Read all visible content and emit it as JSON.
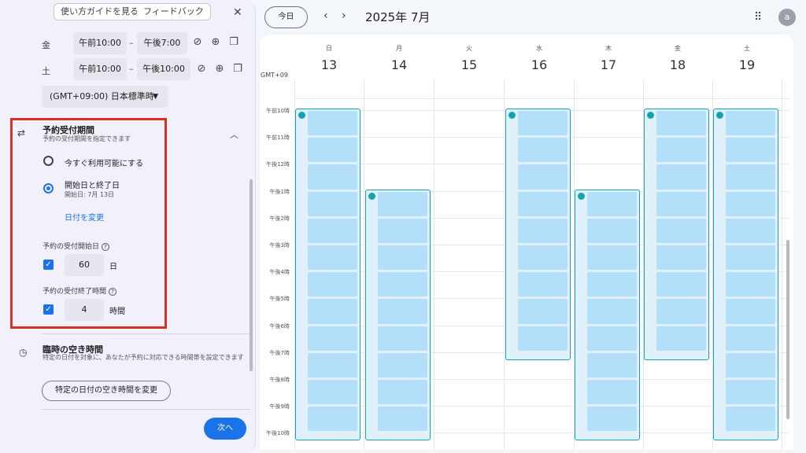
{
  "panel": {
    "guide_label": "使い方ガイドを見る",
    "feedback_label": "フィードバック",
    "close_icon": "close-icon",
    "hours": [
      {
        "day": "金",
        "start": "午前10:00",
        "end": "午後7:00"
      },
      {
        "day": "土",
        "start": "午前10:00",
        "end": "午後10:00"
      }
    ],
    "dash": "–",
    "timezone": "(GMT+09:00) 日本標準時",
    "booking_window": {
      "title": "予約受付期間",
      "subtitle": "予約の受付期間を指定できます",
      "option_now": "今すぐ利用可能にする",
      "option_range": "開始日と終了日",
      "option_range_sub": "開始日: 7月 13日",
      "selected": "option_range",
      "change_date": "日付を変更",
      "start_label": "予約の受付開始日",
      "start_value": "60",
      "start_unit": "日",
      "end_label": "予約の受付終了時間",
      "end_value": "4",
      "end_unit": "時間"
    },
    "temporary": {
      "title": "臨時の空き時間",
      "description": "特定の日付を対象に、あなたが予約に対応できる時間帯を設定できます",
      "button": "特定の日付の空き時間を変更"
    },
    "next_label": "次へ"
  },
  "header": {
    "today_label": "今日",
    "month": "2025年 7月",
    "avatar_letter": "a"
  },
  "calendar": {
    "timezone_label": "GMT+09",
    "days": [
      {
        "dow": "日",
        "date": "13"
      },
      {
        "dow": "月",
        "date": "14"
      },
      {
        "dow": "火",
        "date": "15"
      },
      {
        "dow": "水",
        "date": "16"
      },
      {
        "dow": "木",
        "date": "17"
      },
      {
        "dow": "金",
        "date": "18"
      },
      {
        "dow": "土",
        "date": "19"
      }
    ],
    "hours": [
      "午前10時",
      "午前11時",
      "午後12時",
      "午後1時",
      "午後2時",
      "午後3時",
      "午後4時",
      "午後5時",
      "午後6時",
      "午後7時",
      "午後8時",
      "午後9時",
      "午後10時"
    ],
    "availability": [
      {
        "day": "日",
        "start": "午前10時",
        "end": "午後10時"
      },
      {
        "day": "月",
        "start": "午後1時",
        "end": "午後10時"
      },
      {
        "day": "水",
        "start": "午前10時",
        "end": "午後7時"
      },
      {
        "day": "木",
        "start": "午後1時",
        "end": "午後10時"
      },
      {
        "day": "金",
        "start": "午前10時",
        "end": "午後7時"
      },
      {
        "day": "土",
        "start": "午前10時",
        "end": "午後10時"
      }
    ]
  }
}
